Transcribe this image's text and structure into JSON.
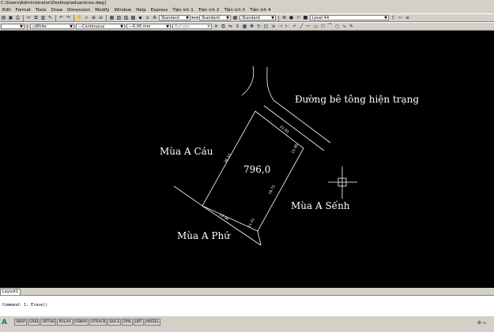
{
  "title": "C:\\Users\\Administrator\\Desktop\\aduantcoo.dwg]",
  "menu": [
    "Edit",
    "Format",
    "Tools",
    "Draw",
    "Dimension",
    "Modify",
    "Window",
    "Help",
    "Express",
    "Tiện ích 1",
    "Tiện ích 2",
    "Tiện ích 3",
    "Tiện ích 4"
  ],
  "toolbar1": {
    "text_style": "Standard",
    "dim_style": "Standard",
    "table_style": "Standard",
    "layer": "Level 44"
  },
  "toolbar2": {
    "color": "White",
    "linetype": "Continuous",
    "lineweight": "0.00 mm",
    "plotstyle": "ByColor"
  },
  "drawing": {
    "road_label": "Đường bê tông hiện trạng",
    "area": "796,0",
    "neighbor_west": "Mùa A Cáu",
    "neighbor_east": "Mùa A Sếnh",
    "neighbor_south": "Mùa A Phứ",
    "dim_top": "21.65",
    "dim_right_upper": "15.98",
    "dim_right_lower": "19.75",
    "dim_left": "36.15",
    "dim_bottom": "19.96",
    "dim_bottom_right": "11.41"
  },
  "layout_tab": "Layout1",
  "command_lines": [
    "",
    "Command: 1: Erase()",
    ""
  ],
  "status_buttons": [
    "SNAP",
    "GRID",
    "ORTHO",
    "POLAR",
    "OSNAP",
    "OTRACK",
    "DUCS",
    "DYN",
    "LWT",
    "MODEL"
  ]
}
